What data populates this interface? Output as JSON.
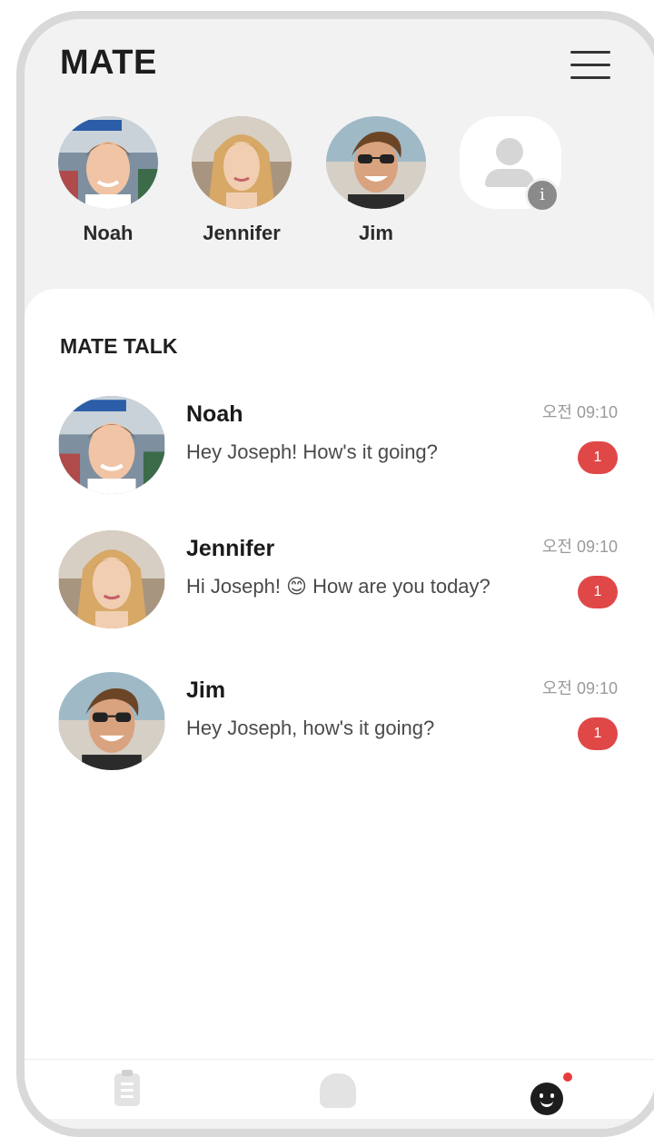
{
  "header": {
    "title": "MATE",
    "menu_icon": "hamburger-menu-icon"
  },
  "mates": [
    {
      "name": "Noah"
    },
    {
      "name": "Jennifer"
    },
    {
      "name": "Jim"
    }
  ],
  "add_mate": {
    "icon": "person-placeholder-icon",
    "info_icon": "info-icon",
    "info_glyph": "i"
  },
  "section": {
    "title": "MATE TALK"
  },
  "chats": [
    {
      "name": "Noah",
      "message": "Hey Joseph! How's it going?",
      "time": "오전 09:10",
      "unread": "1"
    },
    {
      "name": "Jennifer",
      "message": "Hi Joseph! 😊 How are you today?",
      "time": "오전 09:10",
      "unread": "1"
    },
    {
      "name": "Jim",
      "message": "Hey Joseph, how's it going?",
      "time": "오전 09:10",
      "unread": "1"
    }
  ],
  "nav": {
    "items": [
      "clipboard-icon",
      "home-icon",
      "mate-face-icon"
    ],
    "notification_dot_color": "#ea3b3b"
  },
  "colors": {
    "badge": "#e04848",
    "background": "#f2f2f2",
    "frame": "#d9d9d9"
  }
}
